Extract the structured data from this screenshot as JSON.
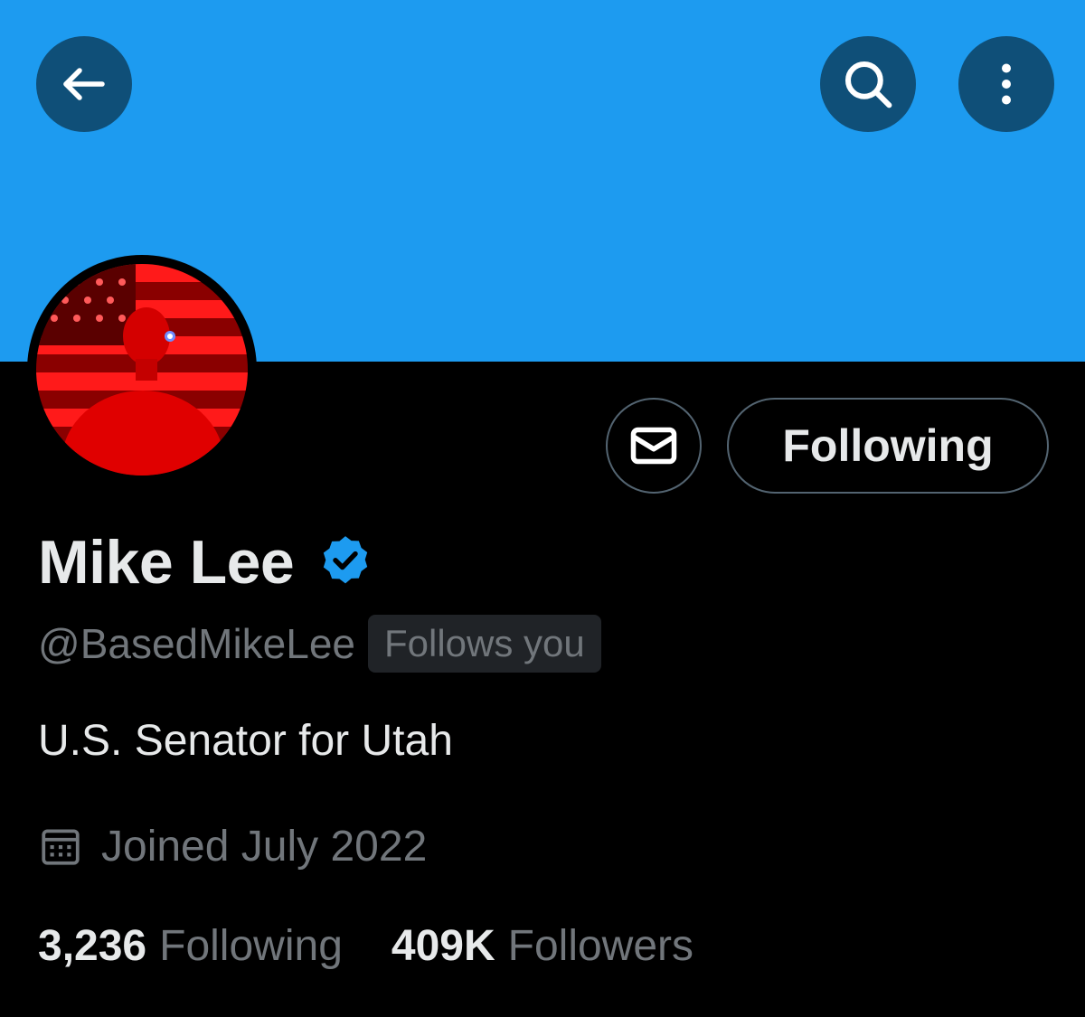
{
  "header": {
    "back_icon": "arrow-left-icon",
    "search_icon": "search-icon",
    "more_icon": "more-vertical-icon",
    "banner_color": "#1d9bf0",
    "button_color": "#0f4f78"
  },
  "profile": {
    "display_name": "Mike Lee",
    "verified_icon": "verified-badge-icon",
    "verified_color": "#1d9bf0",
    "handle": "@BasedMikeLee",
    "follows_you": "Follows you",
    "bio": "U.S. Senator for Utah",
    "joined_icon": "calendar-icon",
    "joined": "Joined July 2022"
  },
  "actions": {
    "message_icon": "envelope-icon",
    "following_label": "Following"
  },
  "stats": {
    "following_count": "3,236",
    "following_label": "Following",
    "followers_count": "409K",
    "followers_label": "Followers"
  }
}
